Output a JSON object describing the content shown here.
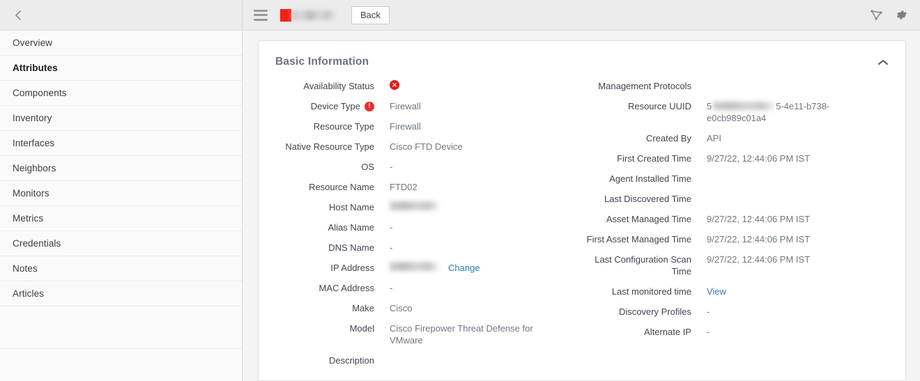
{
  "sidebar": {
    "back_icon": "chevron-left-icon",
    "items": [
      {
        "label": "Overview",
        "active": false
      },
      {
        "label": "Attributes",
        "active": true
      },
      {
        "label": "Components",
        "active": false
      },
      {
        "label": "Inventory",
        "active": false
      },
      {
        "label": "Interfaces",
        "active": false
      },
      {
        "label": "Neighbors",
        "active": false
      },
      {
        "label": "Monitors",
        "active": false
      },
      {
        "label": "Metrics",
        "active": false
      },
      {
        "label": "Credentials",
        "active": false
      },
      {
        "label": "Notes",
        "active": false
      },
      {
        "label": "Articles",
        "active": false
      }
    ]
  },
  "topbar": {
    "menu_icon": "hamburger-menu-icon",
    "status_chip_color": "#f32213",
    "device_title_redacted": "",
    "back_label": "Back",
    "topology_icon": "topology-icon",
    "settings_icon": "gear-icon"
  },
  "card": {
    "title": "Basic Information",
    "collapse_icon": "chevron-up-icon",
    "left_fields": [
      {
        "label": "Availability Status",
        "value": "",
        "kind": "badge-x"
      },
      {
        "label": "Device Type",
        "value": "Firewall",
        "kind": "text",
        "label_badge": "badge-excl"
      },
      {
        "label": "Resource Type",
        "value": "Firewall",
        "kind": "text"
      },
      {
        "label": "Native Resource Type",
        "value": "Cisco FTD Device",
        "kind": "text"
      },
      {
        "label": "OS",
        "value": "-",
        "kind": "text"
      },
      {
        "label": "Resource Name",
        "value": "FTD02",
        "kind": "text"
      },
      {
        "label": "Host Name",
        "value": "",
        "kind": "blur-host"
      },
      {
        "label": "Alias Name",
        "value": "-",
        "kind": "text"
      },
      {
        "label": "DNS Name",
        "value": "-",
        "kind": "text"
      },
      {
        "label": "IP Address",
        "value": "",
        "kind": "blur-ip",
        "action": "Change"
      },
      {
        "label": "MAC Address",
        "value": "-",
        "kind": "text"
      },
      {
        "label": "Make",
        "value": "Cisco",
        "kind": "text"
      },
      {
        "label": "Model",
        "value": "Cisco Firepower Threat Defense for VMware",
        "kind": "text"
      },
      {
        "label": "Description",
        "value": "",
        "kind": "text"
      }
    ],
    "right_fields": [
      {
        "label": "Management Protocols",
        "value": "",
        "kind": "text"
      },
      {
        "label": "Resource UUID",
        "value": "5-4e11-b738-e0cb989c01a4",
        "kind": "uuid",
        "prefix": "5",
        "suffix": "5-4e11-b738-e0cb989c01a4"
      },
      {
        "label": "Created By",
        "value": "API",
        "kind": "text"
      },
      {
        "label": "First Created Time",
        "value": "9/27/22, 12:44:06 PM IST",
        "kind": "text"
      },
      {
        "label": "Agent Installed Time",
        "value": "",
        "kind": "text"
      },
      {
        "label": "Last Discovered Time",
        "value": "",
        "kind": "text"
      },
      {
        "label": "Asset Managed Time",
        "value": "9/27/22, 12:44:06 PM IST",
        "kind": "text"
      },
      {
        "label": "First Asset Managed Time",
        "value": "9/27/22, 12:44:06 PM IST",
        "kind": "text"
      },
      {
        "label": "Last Configuration Scan Time",
        "value": "9/27/22, 12:44:06 PM IST",
        "kind": "text"
      },
      {
        "label": "Last monitored time",
        "value": "View",
        "kind": "link"
      },
      {
        "label": "Discovery Profiles",
        "value": "-",
        "kind": "text"
      },
      {
        "label": "Alternate IP",
        "value": "-",
        "kind": "text"
      }
    ]
  },
  "colors": {
    "accent_link": "#2b7cb8",
    "status_red": "#e21b1b",
    "brand_red": "#f32213",
    "title_gray": "#6b7280"
  }
}
